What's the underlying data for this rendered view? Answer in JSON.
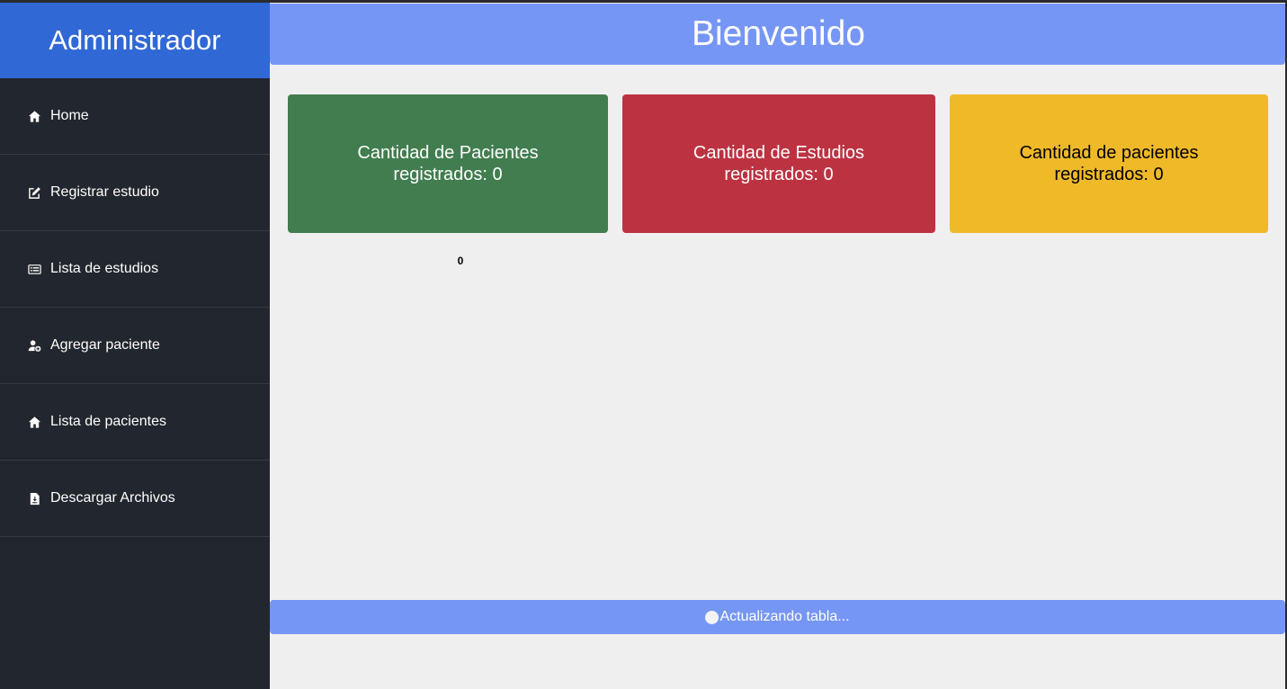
{
  "sidebar": {
    "brand": "Administrador",
    "items": [
      {
        "label": "Home",
        "icon": "home-icon"
      },
      {
        "label": "Registrar estudio",
        "icon": "edit-icon"
      },
      {
        "label": "Lista de estudios",
        "icon": "list-card-icon"
      },
      {
        "label": "Agregar paciente",
        "icon": "user-add-icon"
      },
      {
        "label": "Lista de pacientes",
        "icon": "home-icon"
      },
      {
        "label": "Descargar Archivos",
        "icon": "file-download-icon"
      }
    ]
  },
  "header": {
    "title": "Bienvenido"
  },
  "cards": [
    {
      "line1": "Cantidad de Pacientes",
      "line2": "registrados: 0",
      "color": "#417d4f"
    },
    {
      "line1": "Cantidad de Estudios",
      "line2": "registrados: 0",
      "color": "#bd3241"
    },
    {
      "line1": "Cantidad de pacientes",
      "line2": "registrados: 0",
      "color": "#efb928"
    }
  ],
  "chart_value_label": "0",
  "status": {
    "text": "Actualizando tabla..."
  },
  "colors": {
    "sidebar_bg": "#22262e",
    "brand_bg": "#3068d6",
    "header_bg": "#7696f5",
    "page_bg": "#efefef"
  }
}
